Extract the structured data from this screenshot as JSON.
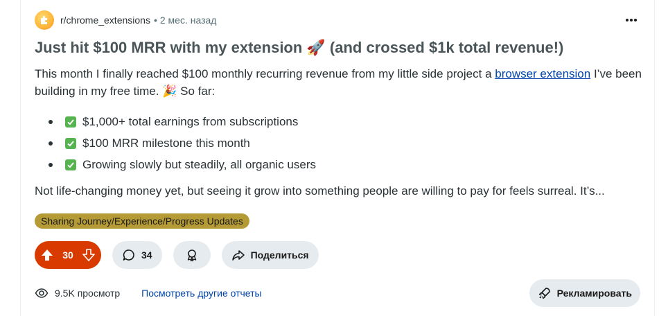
{
  "post": {
    "subreddit": "r/chrome_extensions",
    "separator": "•",
    "time": "2 мес. назад",
    "title": "Just hit $100 MRR with my extension 🚀 (and crossed $1k total revenue!)",
    "body_before_link": "This month I finally reached $100 monthly recurring revenue from my little side project a ",
    "body_link": "browser extension",
    "body_after_link": " I’ve been building in my free time. 🎉 So far:",
    "bullets": [
      "$1,000+ total earnings from subscriptions",
      "$100 MRR milestone this month",
      "Growing slowly but steadily, all organic users"
    ],
    "continuation": "Not life-changing money yet, but seeing it grow into something people are willing to pay for feels surreal. It’s...",
    "flair": "Sharing Journey/Experience/Progress Updates"
  },
  "actions": {
    "votes": "30",
    "comments": "34",
    "share_label": "Поделиться"
  },
  "footer": {
    "views": "9.5K просмотр",
    "other_reports": "Посмотреть другие отчеты",
    "promote_label": "Рекламировать"
  },
  "colors": {
    "upvote_active": "#d93a00",
    "flair_bg": "#b59b35",
    "link": "#0045ac",
    "pill_bg": "#e5ebee"
  },
  "icons": [
    "subreddit-avatar-icon",
    "overflow-menu-icon",
    "upvote-icon",
    "downvote-icon",
    "comment-icon",
    "award-icon",
    "share-icon",
    "eye-icon",
    "promote-icon",
    "checkmark-icon"
  ]
}
